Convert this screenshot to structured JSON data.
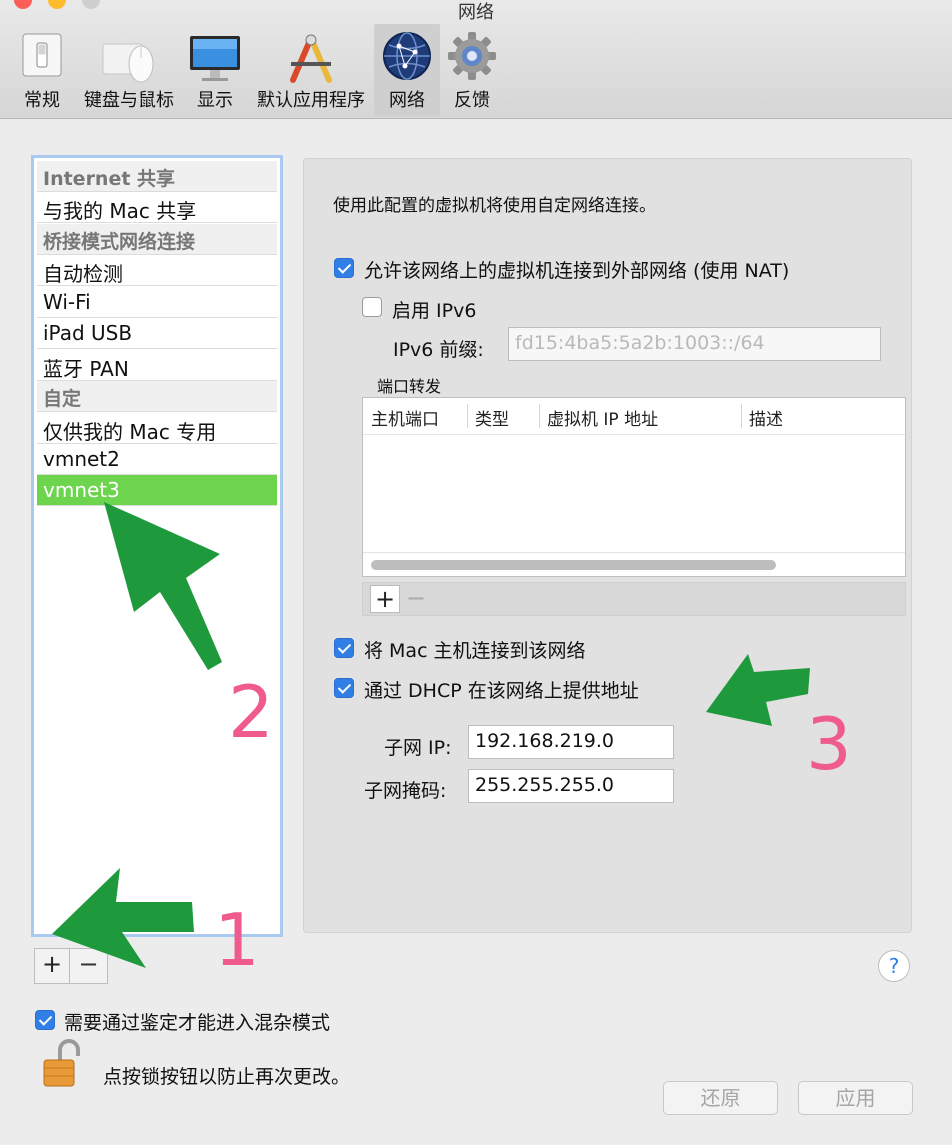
{
  "window": {
    "title": "网络"
  },
  "toolbar": {
    "items": [
      {
        "label": "常规",
        "icon": "switch-icon"
      },
      {
        "label": "键盘与鼠标",
        "icon": "mouse-icon"
      },
      {
        "label": "显示",
        "icon": "monitor-icon"
      },
      {
        "label": "默认应用程序",
        "icon": "app-tools-icon"
      },
      {
        "label": "网络",
        "icon": "globe-icon"
      },
      {
        "label": "反馈",
        "icon": "gear-icon"
      }
    ]
  },
  "sidebar": {
    "items": [
      {
        "label": "Internet 共享",
        "kind": "header"
      },
      {
        "label": "与我的 Mac 共享",
        "kind": "item"
      },
      {
        "label": "桥接模式网络连接",
        "kind": "header"
      },
      {
        "label": "自动检测",
        "kind": "item"
      },
      {
        "label": "Wi-Fi",
        "kind": "item"
      },
      {
        "label": "iPad USB",
        "kind": "item"
      },
      {
        "label": "蓝牙 PAN",
        "kind": "item"
      },
      {
        "label": "自定",
        "kind": "header"
      },
      {
        "label": "仅供我的 Mac 专用",
        "kind": "item"
      },
      {
        "label": "vmnet2",
        "kind": "item"
      },
      {
        "label": "vmnet3",
        "kind": "selected"
      }
    ],
    "add_label": "+",
    "remove_label": "−"
  },
  "panel": {
    "description": "使用此配置的虚拟机将使用自定网络连接。",
    "nat_label": "允许该网络上的虚拟机连接到外部网络 (使用 NAT)",
    "nat_checked": true,
    "ipv6_label": "启用 IPv6",
    "ipv6_checked": false,
    "ipv6_prefix_label": "IPv6 前缀:",
    "ipv6_prefix_value": "fd15:4ba5:5a2b:1003::/64",
    "port_forwarding": {
      "title": "端口转发",
      "columns": [
        "主机端口",
        "类型",
        "虚拟机 IP 地址",
        "描述"
      ],
      "add_label": "+",
      "remove_label": "−"
    },
    "connect_mac_label": "将 Mac 主机连接到该网络",
    "connect_mac_checked": true,
    "dhcp_label": "通过 DHCP 在该网络上提供地址",
    "dhcp_checked": true,
    "subnet_ip_label": "子网 IP:",
    "subnet_ip_value": "192.168.219.0",
    "subnet_mask_label": "子网掩码:",
    "subnet_mask_value": "255.255.255.0"
  },
  "footer": {
    "help_label": "?",
    "promiscuous_label": "需要通过鉴定才能进入混杂模式",
    "promiscuous_checked": true,
    "lock_text": "点按锁按钮以防止再次更改。",
    "revert_label": "还原",
    "apply_label": "应用"
  },
  "annotations": {
    "numbers": [
      "1",
      "2",
      "3"
    ],
    "arrow_color": "#1e9a3c",
    "number_color": "#ef5b8e"
  },
  "colors": {
    "selection": "#6cd44d",
    "checkbox": "#2f7fe6",
    "focus_ring": "#a9c9ef"
  }
}
